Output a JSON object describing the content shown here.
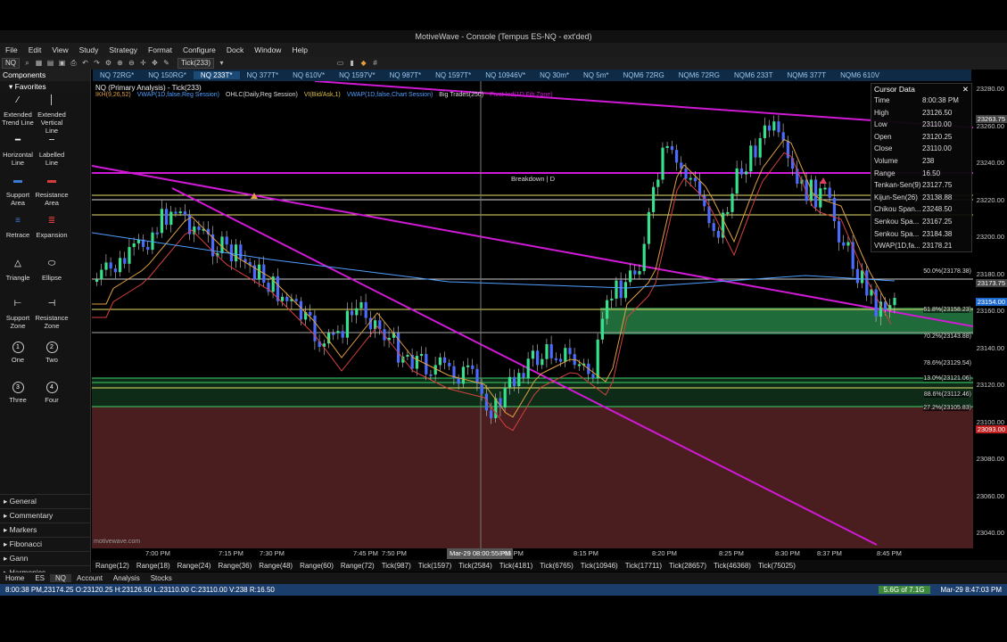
{
  "window": {
    "title": "MotiveWave - Console (Tempus ES-NQ - ext'ded)"
  },
  "menu": [
    "File",
    "Edit",
    "View",
    "Study",
    "Strategy",
    "Format",
    "Configure",
    "Dock",
    "Window",
    "Help"
  ],
  "toolbar": {
    "symbol": "NQ",
    "bar_size": "Tick(233)"
  },
  "tabs": [
    "NQ 72RG*",
    "NQ 150RG*",
    "NQ 233T*",
    "NQ 377T*",
    "NQ 610V*",
    "NQ 1597V*",
    "NQ 987T*",
    "NQ 1597T*",
    "NQ 10946V*",
    "NQ 30m*",
    "NQ 5m*",
    "NQM6 72RG",
    "NQM6 72RG",
    "NQM6 233T",
    "NQM6 377T",
    "NQM6 610V"
  ],
  "active_tab_index": 2,
  "sidebar": {
    "title": "Components",
    "favorites": "Favorites",
    "tools": [
      {
        "label": "Extended Trend Line",
        "icon": "trend-line-icon"
      },
      {
        "label": "Extended Vertical Line",
        "icon": "vertical-line-icon"
      },
      {
        "label": "Horizontal Line",
        "icon": "horizontal-line-icon"
      },
      {
        "label": "Labelled Line",
        "icon": "labelled-line-icon"
      },
      {
        "label": "Support Area",
        "icon": "support-area-icon"
      },
      {
        "label": "Resistance Area",
        "icon": "resistance-area-icon"
      },
      {
        "label": "Retrace",
        "icon": "retrace-icon"
      },
      {
        "label": "Expansion",
        "icon": "expansion-icon"
      },
      {
        "label": "Triangle",
        "icon": "triangle-icon"
      },
      {
        "label": "Ellipse",
        "icon": "ellipse-icon"
      },
      {
        "label": "Support Zone",
        "icon": "support-zone-icon"
      },
      {
        "label": "Resistance Zone",
        "icon": "resistance-zone-icon"
      },
      {
        "label": "One",
        "icon": "marker-1-icon",
        "glyph": "1"
      },
      {
        "label": "Two",
        "icon": "marker-2-icon",
        "glyph": "2"
      },
      {
        "label": "Three",
        "icon": "marker-3-icon",
        "glyph": "3"
      },
      {
        "label": "Four",
        "icon": "marker-4-icon",
        "glyph": "4"
      }
    ],
    "categories": [
      "General",
      "Commentary",
      "Markers",
      "Fibonacci",
      "Gann",
      "Harmonics"
    ]
  },
  "chart": {
    "title": "NQ (Primary Analysis) - Tick(233)",
    "studies": [
      "IKH(9,26,52)",
      "VWAP(1D,false,Reg Session)",
      "OHLC(Daily,Reg Session)",
      "VI(Bid/Ask,1)",
      "VWAP(1D,false,Chart Session)",
      "Big Trades(250)",
      "Pivot Ind(1D,Fib Zone)"
    ],
    "annotation": "Breakdown | D",
    "watermark": "motivewave.com",
    "cursor_time_label": "Mar-29 08:00:55 PM"
  },
  "cursor_data": {
    "title": "Cursor Data",
    "rows": [
      {
        "k": "Time",
        "v": "8:00:38 PM"
      },
      {
        "k": "High",
        "v": "23126.50"
      },
      {
        "k": "Low",
        "v": "23110.00"
      },
      {
        "k": "Open",
        "v": "23120.25"
      },
      {
        "k": "Close",
        "v": "23110.00"
      },
      {
        "k": "Volume",
        "v": "238"
      },
      {
        "k": "Range",
        "v": "16.50"
      },
      {
        "k": "Tenkan-Sen(9)",
        "v": "23127.75"
      },
      {
        "k": "Kijun-Sen(26)",
        "v": "23138.88"
      },
      {
        "k": "Chikou Span...",
        "v": "23248.50"
      },
      {
        "k": "Senkou Spa...",
        "v": "23167.25"
      },
      {
        "k": "Senkou Spa...",
        "v": "23184.38"
      },
      {
        "k": "VWAP(1D,fa...",
        "v": "23178.21"
      }
    ]
  },
  "fib_levels": [
    "50.0%(23178.38)",
    "61.8%(23158.23)",
    "70.2%(23143.88)",
    "78.6%(23129.54)",
    "13.0%(23121.06)",
    "88.6%(23112.46)",
    "27.2%(23105.83)"
  ],
  "y_axis": {
    "labels": [
      "23280.00",
      "23260.00",
      "23240.00",
      "23220.00",
      "23200.00",
      "23180.00",
      "23160.00",
      "23140.00",
      "23120.00",
      "23100.00",
      "23080.00",
      "23060.00",
      "23040.00"
    ],
    "markers": [
      "23263.75",
      "23173.75",
      "23154.00",
      "23093.00"
    ]
  },
  "x_axis": {
    "labels": [
      "7:00 PM",
      "7:15 PM",
      "7:30 PM",
      "7:45 PM",
      "7:50 PM",
      "8:05 PM",
      "8:15 PM",
      "8:20 PM",
      "8:25 PM",
      "8:30 PM",
      "8:37 PM",
      "8:45 PM"
    ]
  },
  "range_bar": [
    "Range(12)",
    "Range(18)",
    "Range(24)",
    "Range(36)",
    "Range(48)",
    "Range(60)",
    "Range(72)",
    "Tick(987)",
    "Tick(1597)",
    "Tick(2584)",
    "Tick(4181)",
    "Tick(6765)",
    "Tick(10946)",
    "Tick(17711)",
    "Tick(28657)",
    "Tick(46368)",
    "Tick(75025)"
  ],
  "bottom_tabs": [
    "Home",
    "ES",
    "NQ",
    "Account",
    "Analysis",
    "Stocks"
  ],
  "status": {
    "left": "8:00:38 PM,23174.25 O:23120.25 H:23126.50 L:23110.00 C:23110.00 V:238 R:16.50",
    "memory": "5.6G of 7.1G",
    "clock": "Mar-29 8:47:03 PM"
  },
  "colors": {
    "bull": "#37e08a",
    "bear": "#4b6bff",
    "magenta": "#d01ad6",
    "yellow": "#e7e26b",
    "green_zone": "#1f6b3a",
    "red_zone": "#4a1d1f"
  }
}
